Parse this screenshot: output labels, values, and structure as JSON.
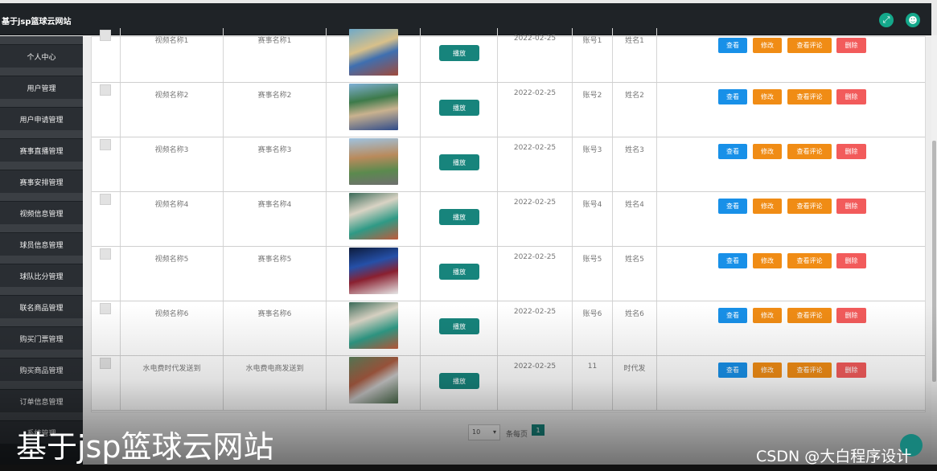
{
  "header": {
    "title": "基于jsp篮球云网站",
    "icons": [
      "fullscreen-icon",
      "user-icon"
    ]
  },
  "sidebar": {
    "items": [
      {
        "label": "个人中心"
      },
      {
        "label": "用户管理"
      },
      {
        "label": "用户申请管理"
      },
      {
        "label": "赛事直播管理"
      },
      {
        "label": "赛事安排管理"
      },
      {
        "label": "视频信息管理"
      },
      {
        "label": "球员信息管理"
      },
      {
        "label": "球队比分管理"
      },
      {
        "label": "联名商品管理"
      },
      {
        "label": "购买门票管理"
      },
      {
        "label": "购买商品管理"
      },
      {
        "label": "订单信息管理"
      },
      {
        "label": "系统管理"
      }
    ]
  },
  "table": {
    "play_label": "播放",
    "actions": {
      "view": "查看",
      "edit": "修改",
      "comments": "查看评论",
      "delete": "删除"
    },
    "rows": [
      {
        "video_name": "视频名称1",
        "event_name": "赛事名称1",
        "date": "2022-02-25",
        "account": "账号1",
        "name": "姓名1"
      },
      {
        "video_name": "视频名称2",
        "event_name": "赛事名称2",
        "date": "2022-02-25",
        "account": "账号2",
        "name": "姓名2"
      },
      {
        "video_name": "视频名称3",
        "event_name": "赛事名称3",
        "date": "2022-02-25",
        "account": "账号3",
        "name": "姓名3"
      },
      {
        "video_name": "视频名称4",
        "event_name": "赛事名称4",
        "date": "2022-02-25",
        "account": "账号4",
        "name": "姓名4"
      },
      {
        "video_name": "视频名称5",
        "event_name": "赛事名称5",
        "date": "2022-02-25",
        "account": "账号5",
        "name": "姓名5"
      },
      {
        "video_name": "视频名称6",
        "event_name": "赛事名称6",
        "date": "2022-02-25",
        "account": "账号6",
        "name": "姓名6"
      },
      {
        "video_name": "水电费时代发送到",
        "event_name": "水电费电商发送到",
        "date": "2022-02-25",
        "account": "11",
        "name": "时代发"
      }
    ]
  },
  "pagination": {
    "page_size": "10",
    "per_page_label": "条每页",
    "current_page": "1"
  },
  "overlay": {
    "caption": "基于jsp篮球云网站",
    "watermark": "CSDN @大白程序设计"
  },
  "colors": {
    "accent": "#17847c",
    "view": "#1890e8",
    "edit": "#f08c15",
    "delete": "#f25b5b"
  }
}
